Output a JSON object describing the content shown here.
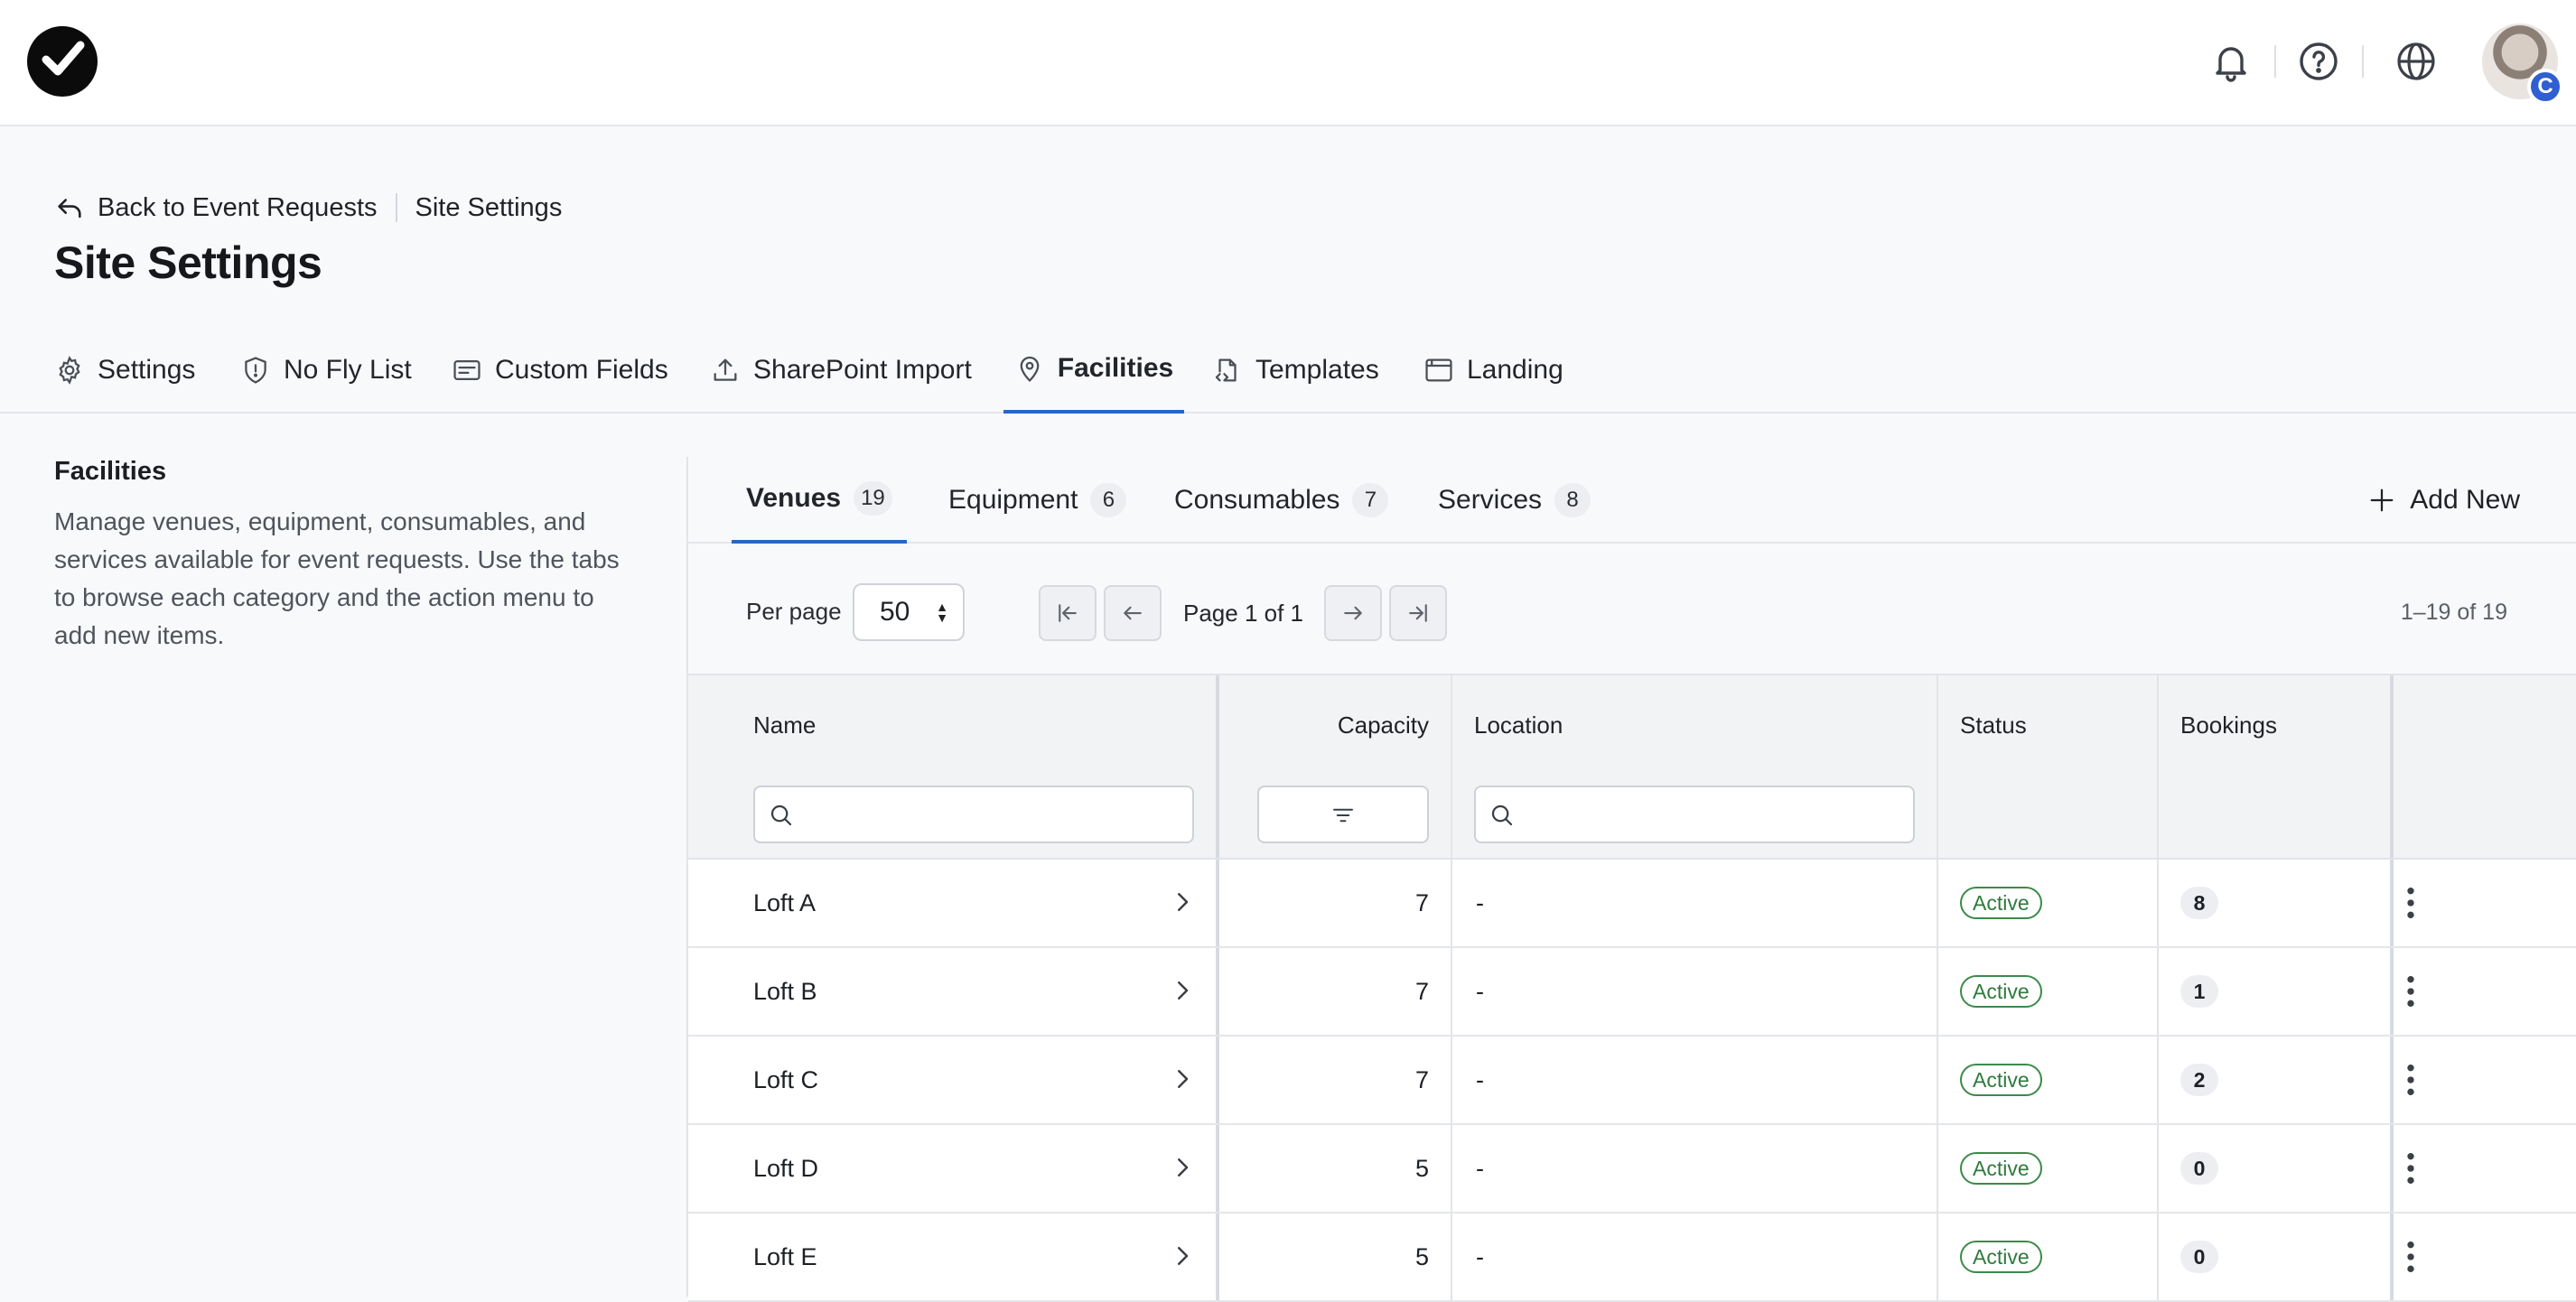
{
  "header": {
    "logo_icon": "checkmark-logo-icon",
    "notifications_icon": "bell-icon",
    "help_icon": "question-circle-icon",
    "language_icon": "globe-icon",
    "avatar_badge": "C"
  },
  "breadcrumb": {
    "back_label": "Back to Event Requests",
    "current": "Site Settings"
  },
  "page_title": "Site Settings",
  "main_tabs": [
    {
      "label": "Settings",
      "icon": "gear-icon"
    },
    {
      "label": "No Fly List",
      "icon": "shield-alert-icon"
    },
    {
      "label": "Custom Fields",
      "icon": "form-fields-icon"
    },
    {
      "label": "SharePoint Import",
      "icon": "upload-icon"
    },
    {
      "label": "Facilities",
      "icon": "map-pin-icon",
      "active": true
    },
    {
      "label": "Templates",
      "icon": "code-file-icon"
    },
    {
      "label": "Landing",
      "icon": "browser-window-icon"
    }
  ],
  "sidebar": {
    "title": "Facilities",
    "description": "Manage venues, equipment, consumables, and services available for event requests. Use the tabs to browse each category and the action menu to add new items."
  },
  "sub_tabs": [
    {
      "label": "Venues",
      "count": "19",
      "active": true
    },
    {
      "label": "Equipment",
      "count": "6"
    },
    {
      "label": "Consumables",
      "count": "7"
    },
    {
      "label": "Services",
      "count": "8"
    }
  ],
  "add_new_label": "Add New",
  "pagination": {
    "per_page_label": "Per page",
    "per_page_value": "50",
    "page_info": "Page 1 of 1",
    "range": "1–19 of 19"
  },
  "table": {
    "columns": {
      "name": "Name",
      "capacity": "Capacity",
      "location": "Location",
      "status": "Status",
      "bookings": "Bookings"
    },
    "rows": [
      {
        "name": "Loft A",
        "capacity": "7",
        "location": "-",
        "status": "Active",
        "bookings": "8"
      },
      {
        "name": "Loft B",
        "capacity": "7",
        "location": "-",
        "status": "Active",
        "bookings": "1"
      },
      {
        "name": "Loft C",
        "capacity": "7",
        "location": "-",
        "status": "Active",
        "bookings": "2"
      },
      {
        "name": "Loft D",
        "capacity": "5",
        "location": "-",
        "status": "Active",
        "bookings": "0"
      },
      {
        "name": "Loft E",
        "capacity": "5",
        "location": "-",
        "status": "Active",
        "bookings": "0"
      }
    ]
  },
  "colors": {
    "accent": "#2a64c8",
    "status_active": "#2f7a3d"
  }
}
